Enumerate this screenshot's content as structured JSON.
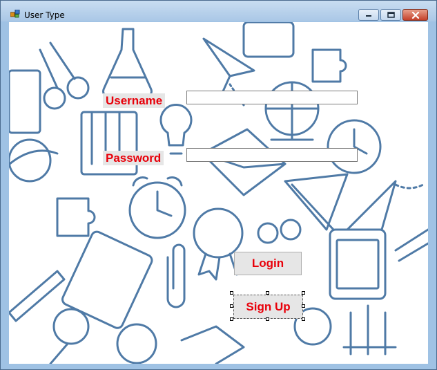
{
  "window": {
    "title": "User Type",
    "controls": {
      "minimize": "minimize",
      "maximize": "maximize",
      "close": "close"
    }
  },
  "form": {
    "username_label": "Username",
    "password_label": "Password",
    "username_value": "",
    "password_value": "",
    "login_label": "Login",
    "signup_label": "Sign Up"
  },
  "colors": {
    "label_text": "#e8000a",
    "doodle_stroke": "#4f7aa6",
    "titlebar": "#a9c7e6"
  },
  "icons": [
    "app-icon",
    "minimize-icon",
    "maximize-icon",
    "close-icon"
  ]
}
